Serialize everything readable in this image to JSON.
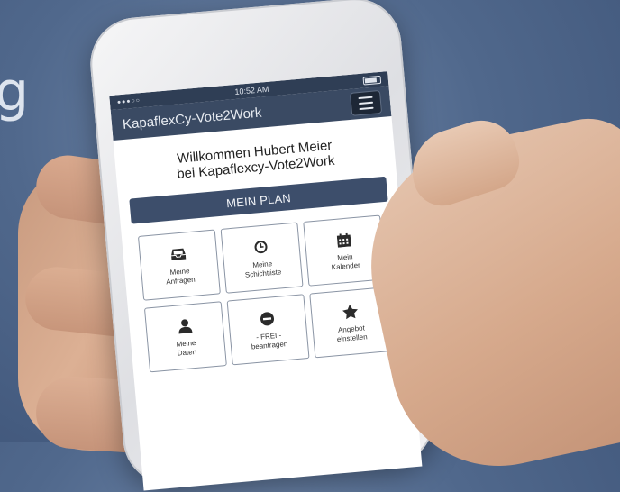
{
  "background": {
    "letter": "g"
  },
  "statusbar": {
    "signal": "●●●○○",
    "time": "10:52 AM"
  },
  "appbar": {
    "title": "KapaflexCy-Vote2Work"
  },
  "welcome": {
    "line1": "Willkommen Hubert Meier",
    "line2": "bei Kapaflexcy-Vote2Work"
  },
  "plan_button": {
    "label": "MEIN PLAN"
  },
  "tiles": [
    {
      "icon": "inbox-icon",
      "label": "Meine\nAnfragen"
    },
    {
      "icon": "clock-icon",
      "label": "Meine\nSchichtliste"
    },
    {
      "icon": "calendar-icon",
      "label": "Mein\nKalender"
    },
    {
      "icon": "user-icon",
      "label": "Meine\nDaten"
    },
    {
      "icon": "minus-circle-icon",
      "label": "- FREI -\nbeantragen"
    },
    {
      "icon": "star-icon",
      "label": "Angebot\neinstellen"
    }
  ],
  "colors": {
    "appbar": "#3a4a63",
    "button": "#3d4e6b",
    "statusbar": "#2f3e55"
  }
}
